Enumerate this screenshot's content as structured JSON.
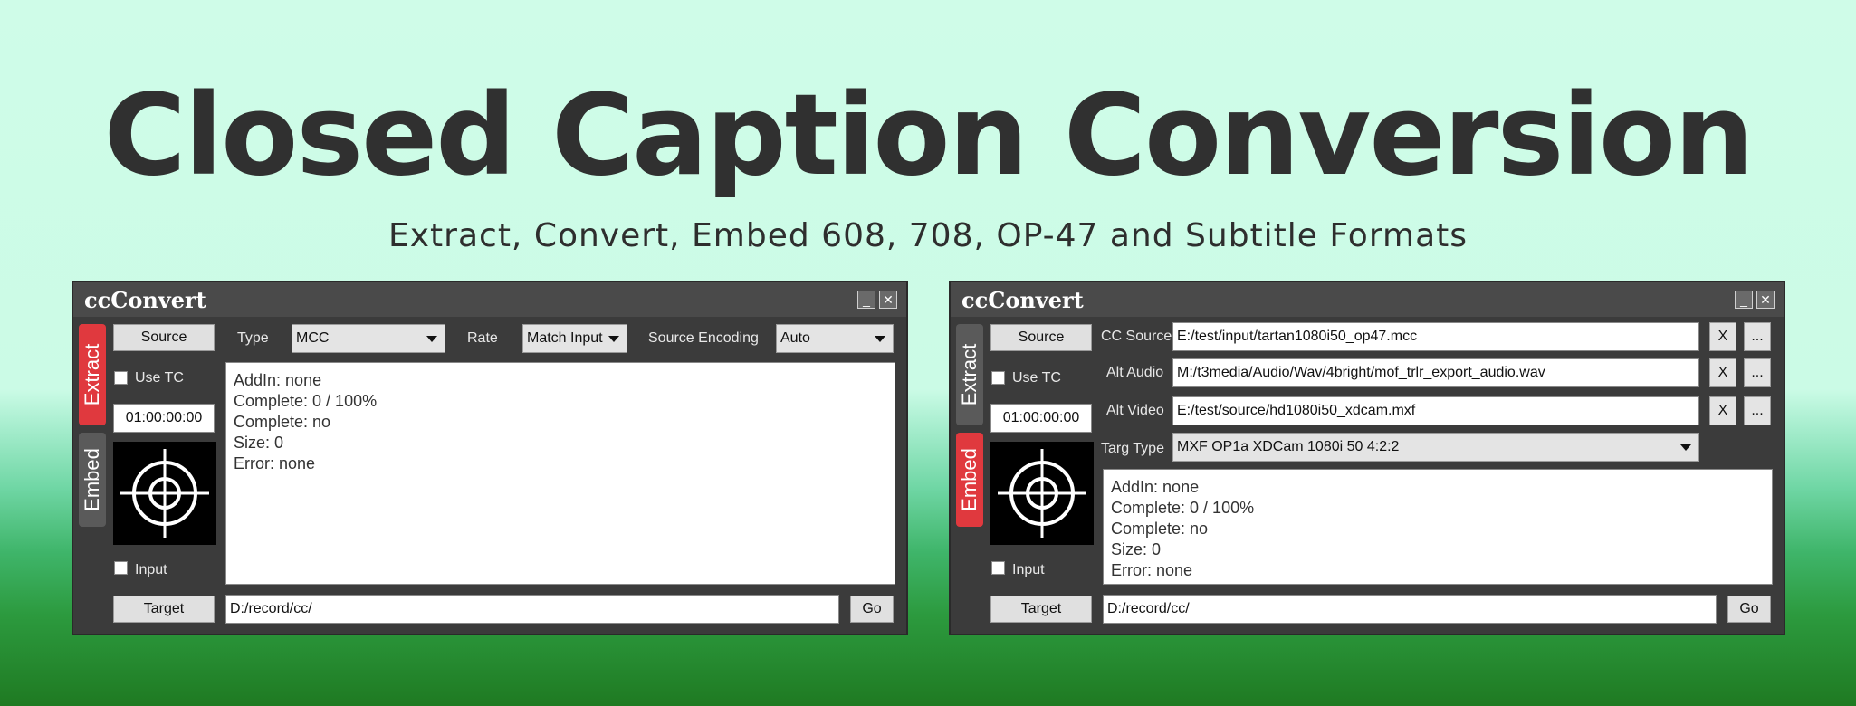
{
  "hero": {
    "title": "Closed Caption Conversion",
    "subtitle": "Extract, Convert, Embed 608, 708, OP-47 and Subtitle Formats"
  },
  "colors": {
    "background_top": "#cffce8",
    "background_bottom": "#1f7a22",
    "window_bg": "#3b3b3b",
    "active_tab": "#e0393e",
    "inactive_tab": "#5a5a5a"
  },
  "left_window": {
    "app_title": "ccConvert",
    "minimize_label": "_",
    "close_label": "✕",
    "tabs": {
      "extract": "Extract",
      "embed": "Embed",
      "active": "Extract"
    },
    "source_button": "Source",
    "use_tc_label": "Use TC",
    "use_tc_checked": false,
    "timecode": "01:00:00:00",
    "input_label": "Input",
    "input_checked": false,
    "type_label": "Type",
    "type_value": "MCC",
    "rate_label": "Rate",
    "rate_value": "Match Input",
    "encoding_label": "Source Encoding",
    "encoding_value": "Auto",
    "log": [
      "AddIn: none",
      "Complete: 0 / 100%",
      "Complete: no",
      "Size: 0",
      "Error: none"
    ],
    "target_button": "Target",
    "target_path": "D:/record/cc/",
    "go_button": "Go",
    "icon": "crosshair-target-icon"
  },
  "right_window": {
    "app_title": "ccConvert",
    "minimize_label": "_",
    "close_label": "✕",
    "tabs": {
      "extract": "Extract",
      "embed": "Embed",
      "active": "Embed"
    },
    "source_button": "Source",
    "use_tc_label": "Use TC",
    "use_tc_checked": false,
    "timecode": "01:00:00:00",
    "input_label": "Input",
    "input_checked": false,
    "cc_source_label": "CC Source",
    "cc_source_value": "E:/test/input/tartan1080i50_op47.mcc",
    "alt_audio_label": "Alt Audio",
    "alt_audio_value": "M:/t3media/Audio/Wav/4bright/mof_trlr_export_audio.wav",
    "alt_video_label": "Alt Video",
    "alt_video_value": "E:/test/source/hd1080i50_xdcam.mxf",
    "clear_label": "X",
    "browse_label": "...",
    "targ_type_label": "Targ Type",
    "targ_type_value": "MXF OP1a XDCam 1080i 50 4:2:2",
    "log": [
      "AddIn: none",
      "Complete: 0 / 100%",
      "Complete: no",
      "Size: 0",
      "Error: none"
    ],
    "target_button": "Target",
    "target_path": "D:/record/cc/",
    "go_button": "Go",
    "icon": "crosshair-target-icon"
  }
}
